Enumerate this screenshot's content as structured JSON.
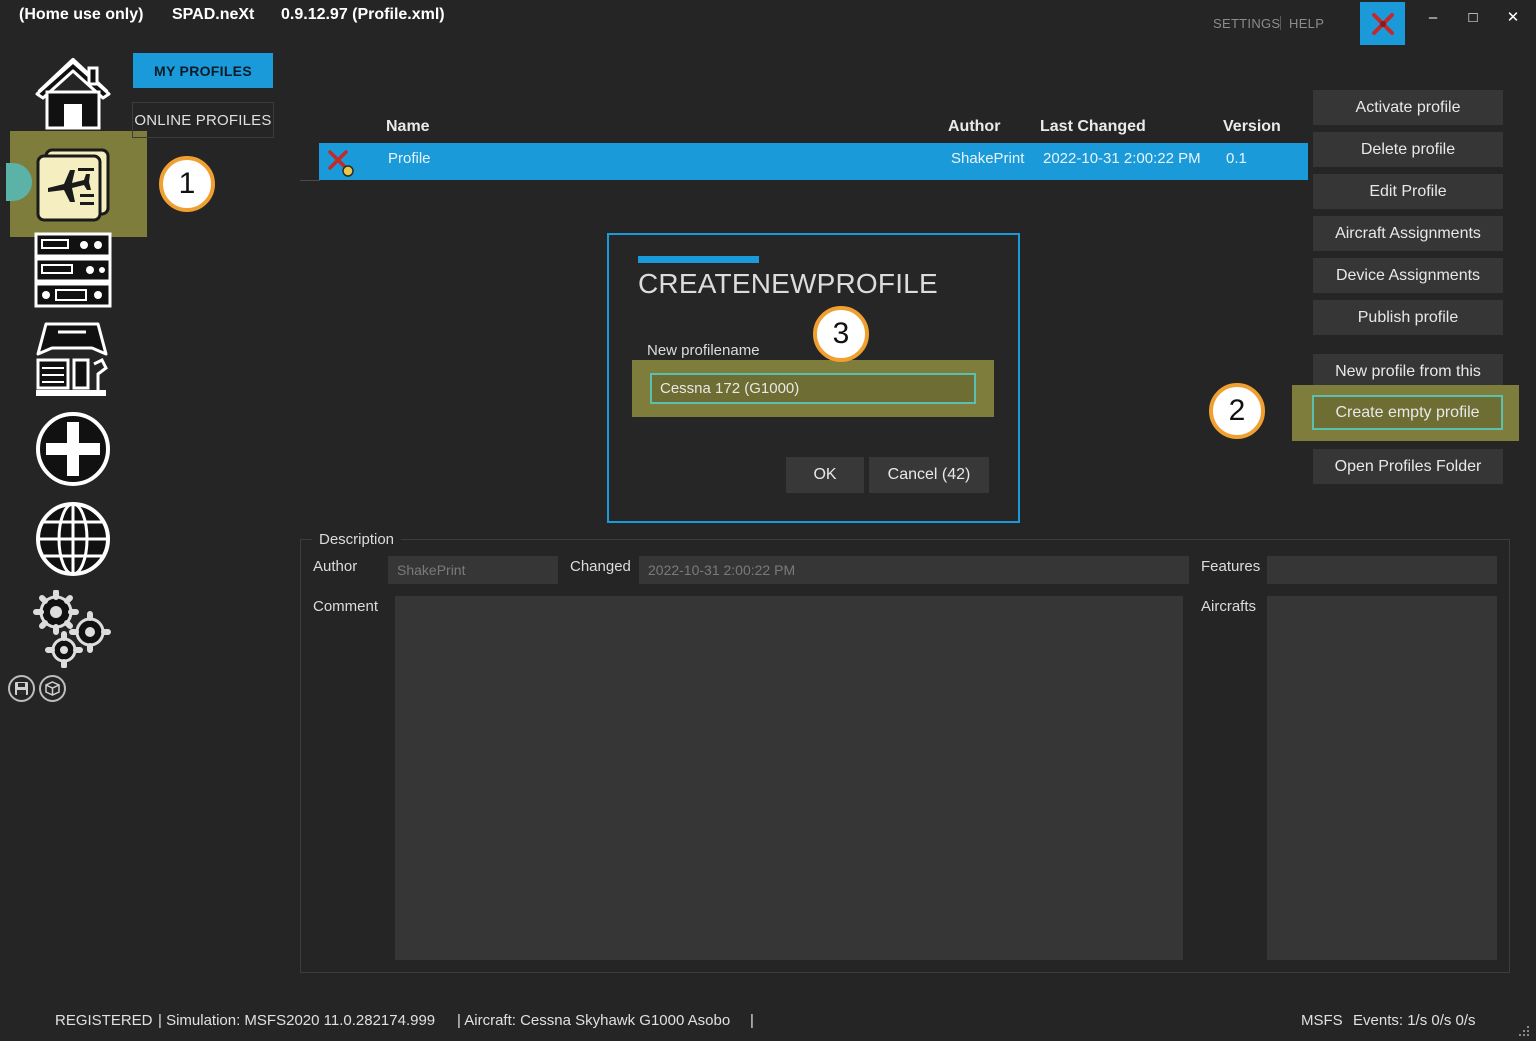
{
  "titlebar": {
    "edition": "(Home use only)",
    "app_name": "SPAD.neXt",
    "version_file": "0.9.12.97 (Profile.xml)",
    "settings": "SETTINGS",
    "help": "HELP",
    "minimize": "–",
    "maximize": "□",
    "close": "✕"
  },
  "tabs": {
    "my_profiles": "MY PROFILES",
    "online_profiles": "ONLINE PROFILES"
  },
  "table": {
    "columns": {
      "name": "Name",
      "author": "Author",
      "last_changed": "Last Changed",
      "version": "Version"
    },
    "rows": [
      {
        "name": "Profile",
        "author": "ShakePrint",
        "last_changed": "2022-10-31 2:00:22 PM",
        "version": "0.1"
      }
    ]
  },
  "actions": {
    "activate": "Activate profile",
    "delete": "Delete profile",
    "edit": "Edit Profile",
    "aircraft_assignments": "Aircraft Assignments",
    "device_assignments": "Device Assignments",
    "publish": "Publish profile",
    "new_from_this": "New profile from this",
    "create_empty": "Create empty profile",
    "open_folder": "Open Profiles Folder"
  },
  "dialog": {
    "title": "CREATENEWPROFILE",
    "label": "New profilename",
    "input_value": "Cessna 172 (G1000)",
    "ok": "OK",
    "cancel": "Cancel (42)"
  },
  "callouts": {
    "one": "1",
    "two": "2",
    "three": "3"
  },
  "description": {
    "legend": "Description",
    "author_label": "Author",
    "author_value": "ShakePrint",
    "changed_label": "Changed",
    "changed_value": "2022-10-31 2:00:22 PM",
    "features_label": "Features",
    "features_value": "",
    "comment_label": "Comment",
    "comment_value": "",
    "aircrafts_label": "Aircrafts",
    "aircrafts_value": ""
  },
  "statusbar": {
    "registered": "REGISTERED",
    "simulation": "| Simulation: MSFS2020 11.0.282174.999",
    "aircraft": "| Aircraft: Cessna Skyhawk G1000 Asobo",
    "trailing_sep": "|",
    "sim": "MSFS",
    "events": "Events: 1/s 0/s 0/s"
  },
  "colors": {
    "accent": "#1a9ad9",
    "highlight": "#7e7d3c",
    "callout_ring": "#f0a030",
    "focus_border": "#5bc0b0"
  },
  "icons": {
    "nav": [
      "home-icon",
      "profiles-icon",
      "devices-icon",
      "cockpit-icon",
      "add-icon",
      "globe-icon",
      "settings-gears-icon"
    ],
    "small": [
      "save-icon",
      "package-icon"
    ],
    "app": "spad-logo-icon"
  }
}
